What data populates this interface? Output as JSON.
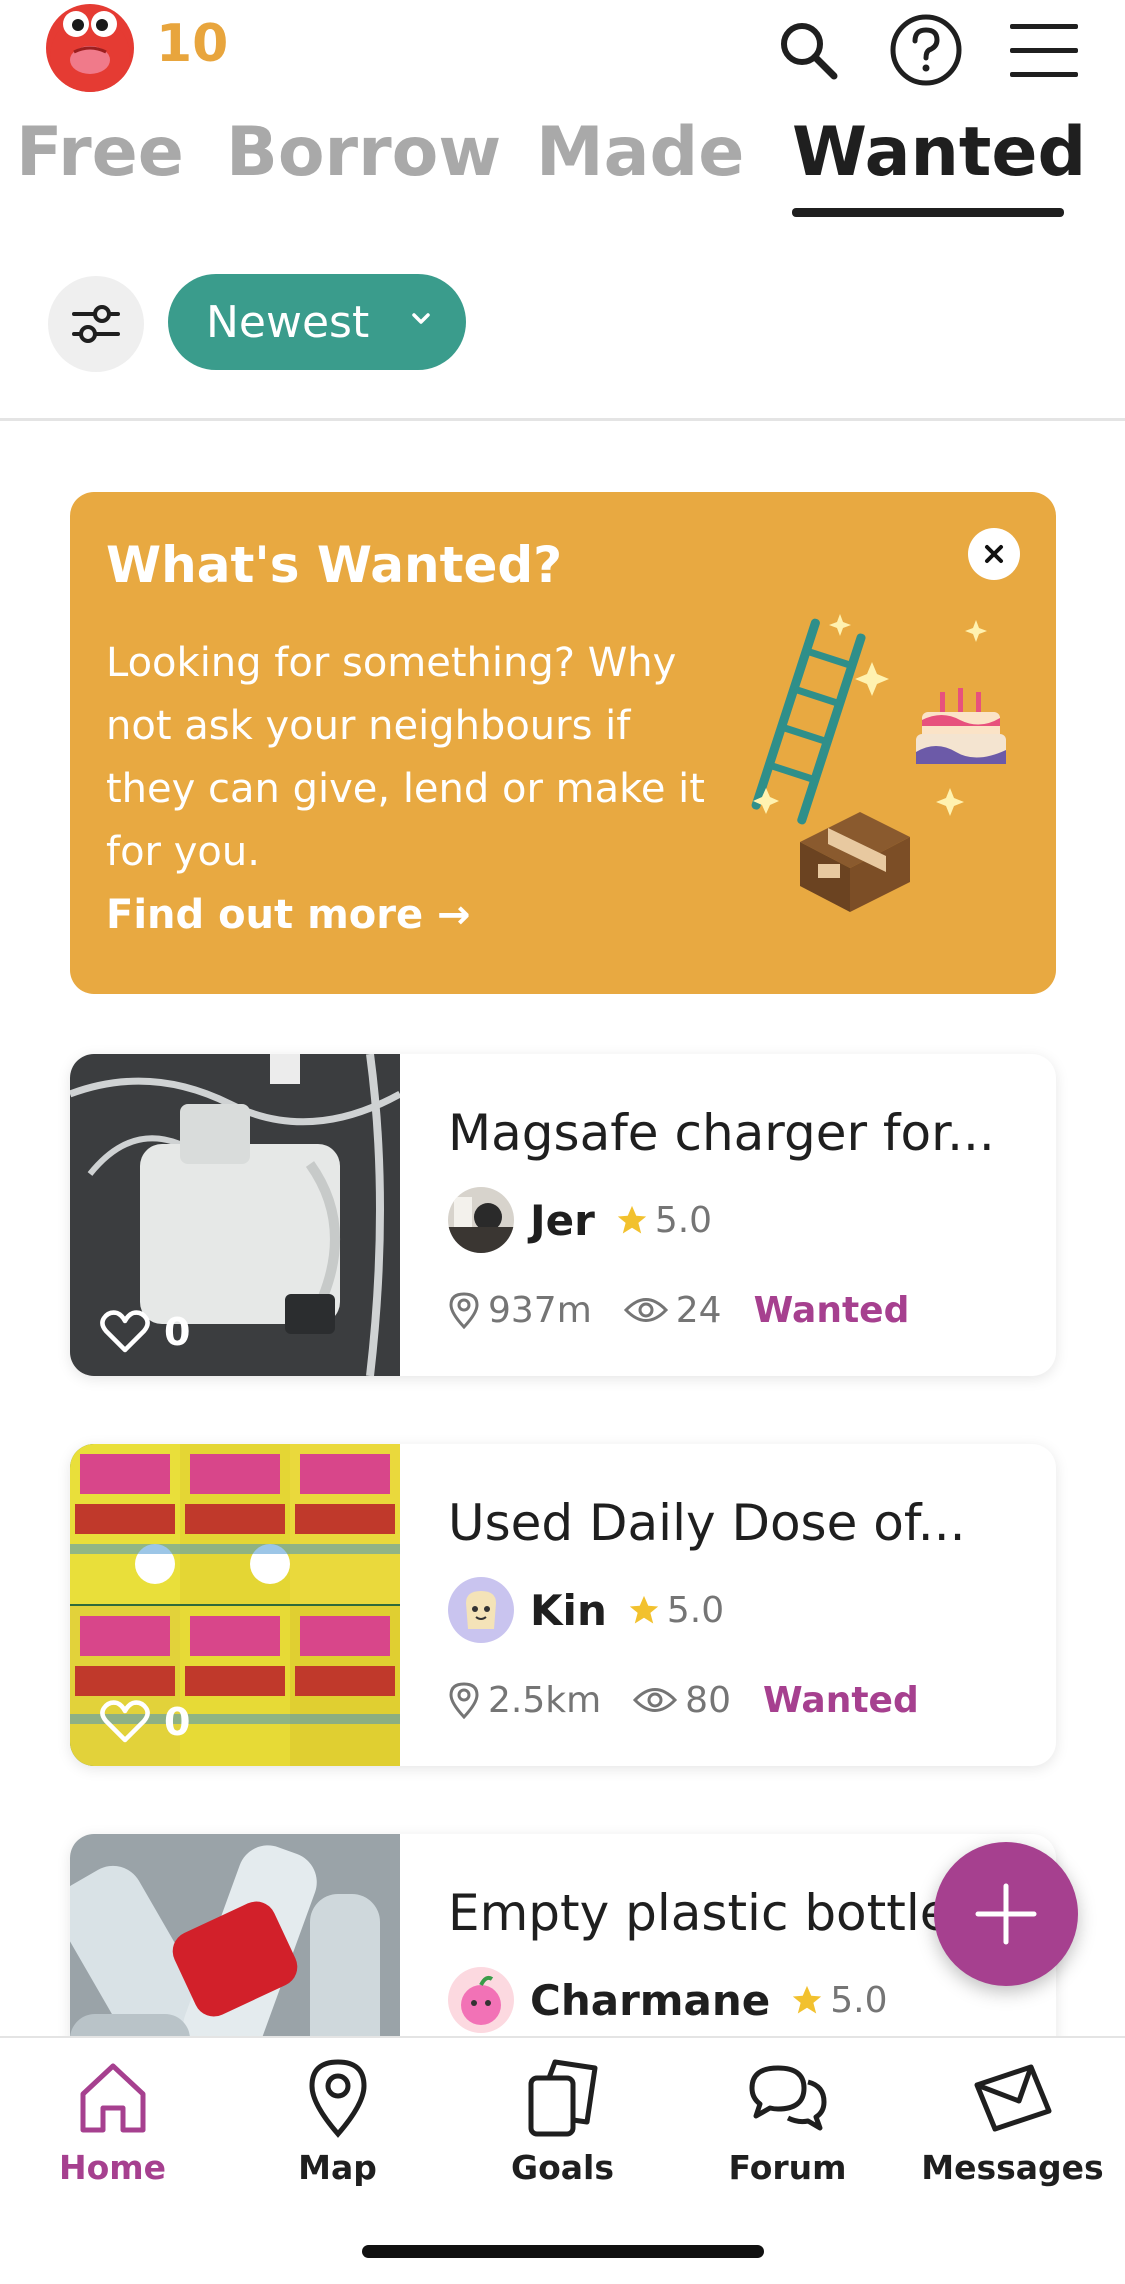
{
  "header": {
    "points": "10",
    "icons": [
      "search-icon",
      "help-icon",
      "menu-icon"
    ]
  },
  "tabs": [
    {
      "label": "Free",
      "active": false
    },
    {
      "label": "Borrow",
      "active": false
    },
    {
      "label": "Made",
      "active": false
    },
    {
      "label": "Wanted",
      "active": true
    }
  ],
  "filter": {
    "sort_label": "Newest"
  },
  "banner": {
    "title": "What's Wanted?",
    "text": "Looking for something? Why not ask your neighbours if they can give, lend or make it for you.",
    "link": "Find out more →"
  },
  "listings": [
    {
      "title": "Magsafe charger for...",
      "user": "Jer",
      "rating": "5.0",
      "likes": "0",
      "distance": "937m",
      "views": "24",
      "status": "Wanted"
    },
    {
      "title": "Used Daily Dose of...",
      "user": "Kin",
      "rating": "5.0",
      "likes": "0",
      "distance": "2.5km",
      "views": "80",
      "status": "Wanted"
    },
    {
      "title": "Empty plastic bottle",
      "user": "Charmane",
      "rating": "5.0"
    }
  ],
  "bottom_nav": [
    {
      "label": "Home",
      "icon": "home-icon",
      "active": true
    },
    {
      "label": "Map",
      "icon": "map-pin-icon",
      "active": false
    },
    {
      "label": "Goals",
      "icon": "goals-icon",
      "active": false
    },
    {
      "label": "Forum",
      "icon": "forum-icon",
      "active": false
    },
    {
      "label": "Messages",
      "icon": "envelope-icon",
      "active": false
    }
  ],
  "colors": {
    "accent_purple": "#a6408f",
    "teal": "#3a9c8c",
    "banner_orange": "#e8a941",
    "points_orange": "#e8a53d"
  }
}
